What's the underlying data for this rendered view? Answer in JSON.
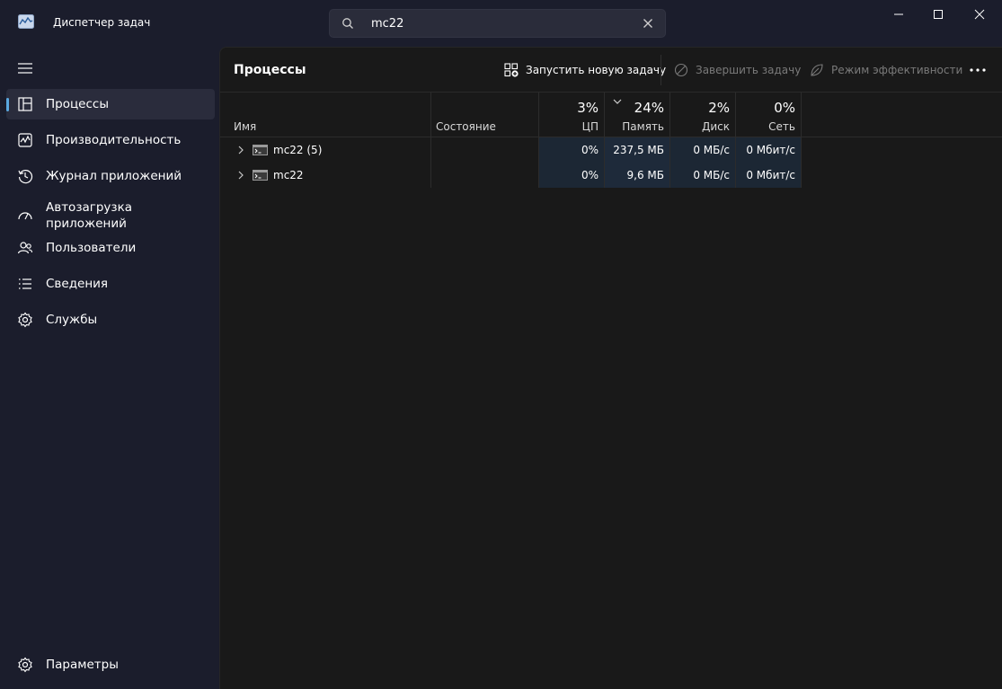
{
  "app": {
    "title": "Диспетчер задач"
  },
  "search": {
    "value": "mc22"
  },
  "nav": {
    "items": [
      {
        "label": "Процессы"
      },
      {
        "label": "Производительность"
      },
      {
        "label": "Журнал приложений"
      },
      {
        "label": "Автозагрузка\nприложений"
      },
      {
        "label": "Пользователи"
      },
      {
        "label": "Сведения"
      },
      {
        "label": "Службы"
      }
    ],
    "settings_label": "Параметры"
  },
  "page": {
    "title": "Процессы"
  },
  "toolbar": {
    "run_task": "Запустить новую задачу",
    "end_task": "Завершить задачу",
    "efficiency": "Режим эффективности"
  },
  "columns": {
    "name": "Имя",
    "status": "Состояние",
    "cpu": {
      "pct": "3%",
      "label": "ЦП"
    },
    "memory": {
      "pct": "24%",
      "label": "Память"
    },
    "disk": {
      "pct": "2%",
      "label": "Диск"
    },
    "network": {
      "pct": "0%",
      "label": "Сеть"
    }
  },
  "processes": [
    {
      "name": "mc22 (5)",
      "status": "",
      "cpu": "0%",
      "memory": "237,5 МБ",
      "disk": "0 МБ/с",
      "network": "0 Мбит/с"
    },
    {
      "name": "mc22",
      "status": "",
      "cpu": "0%",
      "memory": "9,6 МБ",
      "disk": "0 МБ/с",
      "network": "0 Мбит/с"
    }
  ],
  "colors": {
    "accent": "#5aa8e0",
    "sidebar_bg": "#1b1d2c",
    "content_bg": "#191919",
    "resource_cell": "#1c2734"
  }
}
